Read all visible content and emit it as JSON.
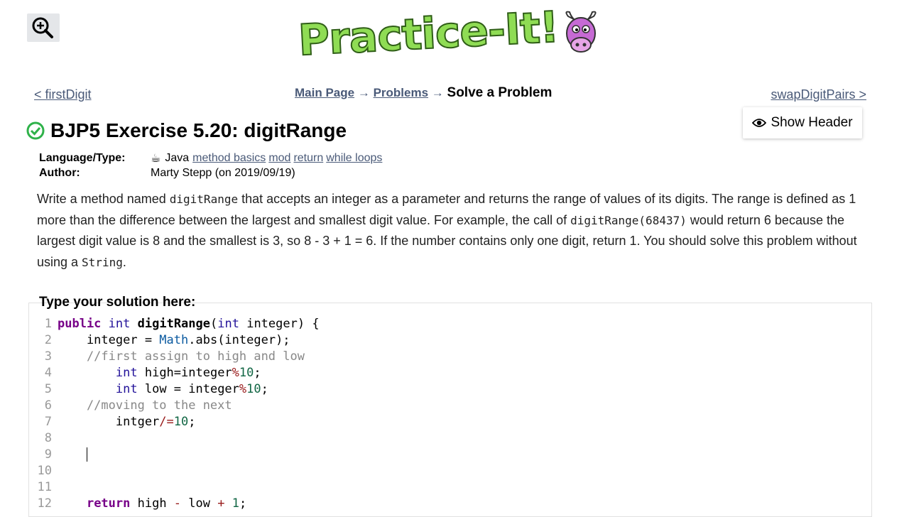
{
  "logo_text": "Practice-It!",
  "nav": {
    "prev": "< firstDigit",
    "next": "swapDigitPairs >",
    "breadcrumb": {
      "main_page": "Main Page",
      "arrow": "→",
      "problems": "Problems",
      "current": "Solve a Problem"
    },
    "show_header": "Show Header"
  },
  "problem": {
    "title": "BJP5 Exercise 5.20: digitRange",
    "language_label": "Language/Type:",
    "language": "Java",
    "tags": [
      "method basics",
      "mod",
      "return",
      "while loops"
    ],
    "author_label": "Author:",
    "author": "Marty Stepp (on 2019/09/19)",
    "description": {
      "p1": "Write a method named ",
      "c1": "digitRange",
      "p2": " that accepts an integer as a parameter and returns the range of values of its digits. The range is defined as 1 more than the difference between the largest and smallest digit value. For example, the call of ",
      "c2": "digitRange(68437)",
      "p3": " would return 6 because the largest digit value is 8 and the smallest is 3, so 8 - 3 + 1 = 6. If the number contains only one digit, return 1. You should solve this problem without using a ",
      "c3": "String",
      "p4": "."
    }
  },
  "editor": {
    "label": "Type your solution here:",
    "line_numbers": [
      "1",
      "2",
      "3",
      "4",
      "5",
      "6",
      "7",
      "8",
      "9",
      "10",
      "11",
      "12"
    ],
    "lines": [
      "public int digitRange(int integer) {",
      "    integer = Math.abs(integer);",
      "    //first assign to high and low",
      "        int high=integer%10;",
      "        int low = integer%10;",
      "    //moving to the next",
      "        intger/=10;",
      "",
      "    ",
      "",
      "",
      "    return high - low + 1;"
    ]
  },
  "colors": {
    "link": "#4a5a78",
    "keyword": "#770088",
    "number": "#116644",
    "comment": "#888888",
    "check": "#2fb24a"
  }
}
